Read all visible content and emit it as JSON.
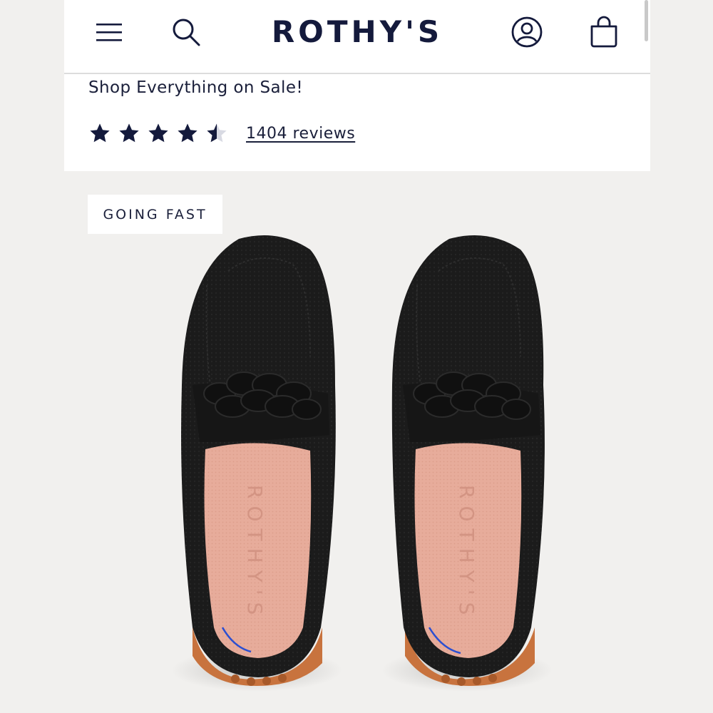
{
  "header": {
    "logo": "ROTHY'S",
    "menu_icon": "hamburger-menu-icon",
    "search_icon": "search-icon",
    "account_icon": "account-icon",
    "bag_icon": "shopping-bag-icon"
  },
  "product": {
    "promo_text": "Shop Everything on Sale!",
    "rating": 4.5,
    "rating_max": 5,
    "reviews_label": "1404 reviews",
    "badge": "GOING FAST",
    "insole_brand": "ROTHY'S"
  },
  "colors": {
    "navy": "#141a3c",
    "background": "#f1f0ee",
    "shoe": "#1b1b1b",
    "insole": "#e6aa98",
    "sole": "#c8733e",
    "accent_stitch": "#2b4fd1"
  }
}
